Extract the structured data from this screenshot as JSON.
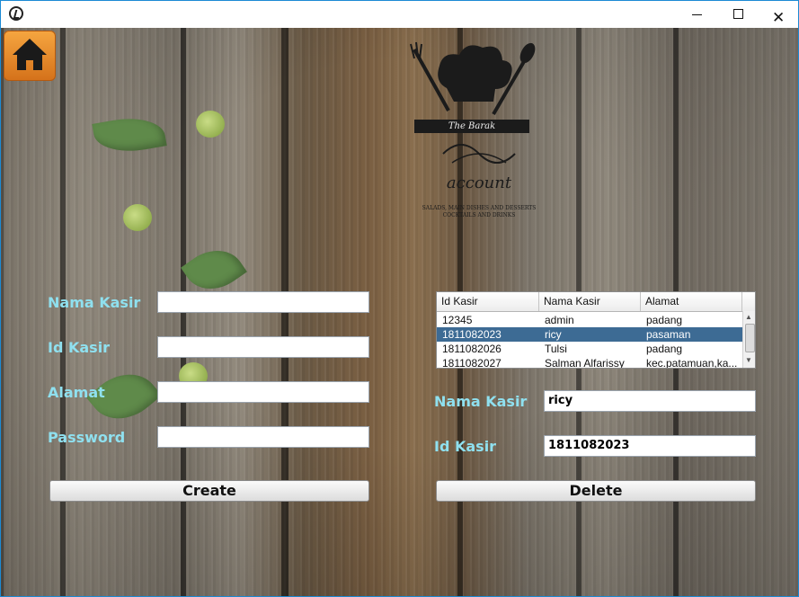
{
  "window": {
    "minimize_glyph": "",
    "maximize_glyph": "",
    "close_glyph": "✕"
  },
  "logo": {
    "name": "The Barak",
    "script": "account",
    "tagline_1": "SALADS, MAIN DISHES AND DESSERTS",
    "tagline_2": "COCKTAILS AND DRINKS"
  },
  "form": {
    "nama_kasir_label": "Nama Kasir",
    "nama_kasir_value": "",
    "id_kasir_label": "Id Kasir",
    "id_kasir_value": "",
    "alamat_label": "Alamat",
    "alamat_value": "",
    "password_label": "Password",
    "password_value": "",
    "create_label": "Create"
  },
  "table": {
    "columns": [
      "Id Kasir",
      "Nama Kasir",
      "Alamat"
    ],
    "rows": [
      {
        "id": "12345",
        "nama": "admin",
        "alamat": "padang"
      },
      {
        "id": "1811082023",
        "nama": "ricy",
        "alamat": "pasaman"
      },
      {
        "id": "1811082026",
        "nama": "Tulsi",
        "alamat": "padang"
      },
      {
        "id": "1811082027",
        "nama": "Salman Alfarissy",
        "alamat": "kec.patamuan,ka..."
      }
    ],
    "selected_index": 1
  },
  "detail": {
    "nama_kasir_label": "Nama Kasir",
    "nama_kasir_value": "ricy",
    "id_kasir_label": "Id Kasir",
    "id_kasir_value": "1811082023",
    "delete_label": "Delete"
  },
  "icons": {
    "app": "app-icon",
    "home": "home-icon"
  },
  "colors": {
    "label": "#8fe0ef",
    "home_button": "#e8891f",
    "selected_row": "#3d6b94"
  }
}
